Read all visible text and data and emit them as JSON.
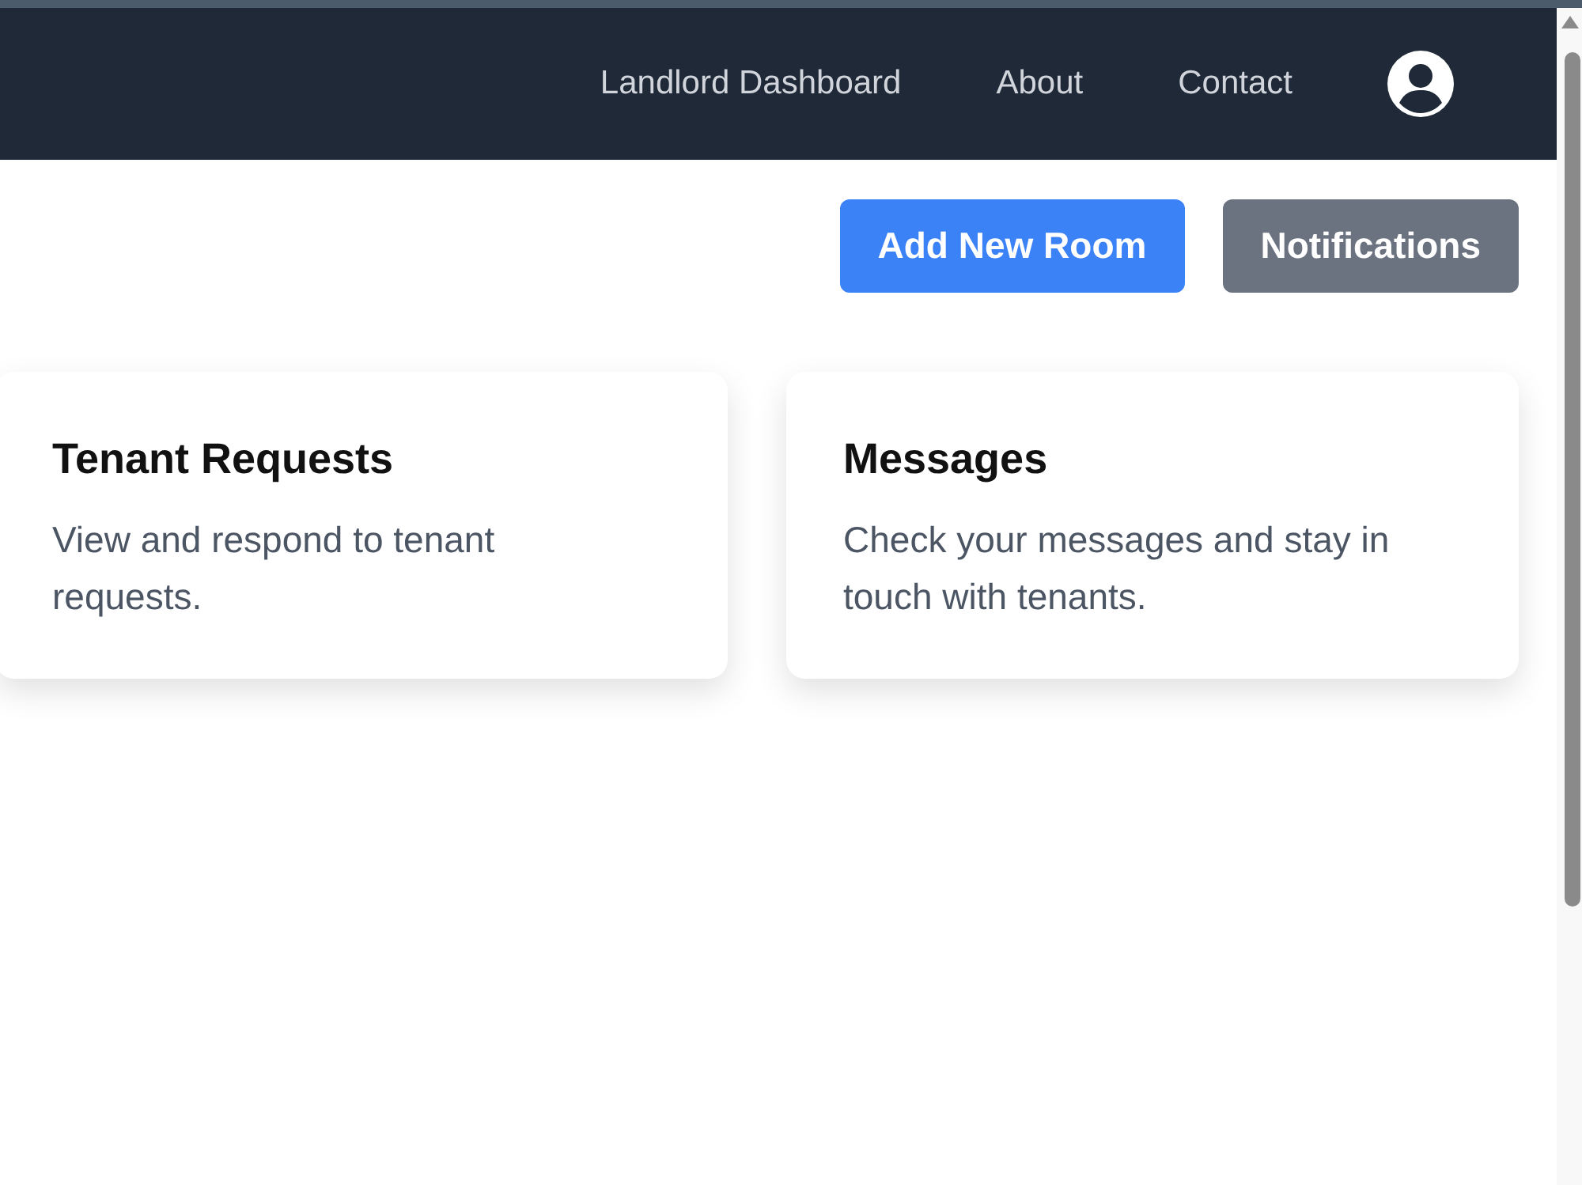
{
  "nav": {
    "links": [
      "Landlord Dashboard",
      "About",
      "Contact"
    ]
  },
  "actions": [
    {
      "label": "Add New Room",
      "kind": "primary"
    },
    {
      "label": "Notifications",
      "kind": "secondary"
    }
  ],
  "cards": [
    {
      "title": "Tenant Requests",
      "description": "View and respond to tenant requests."
    },
    {
      "title": "Messages",
      "description": "Check your messages and stay in touch with tenants."
    }
  ]
}
